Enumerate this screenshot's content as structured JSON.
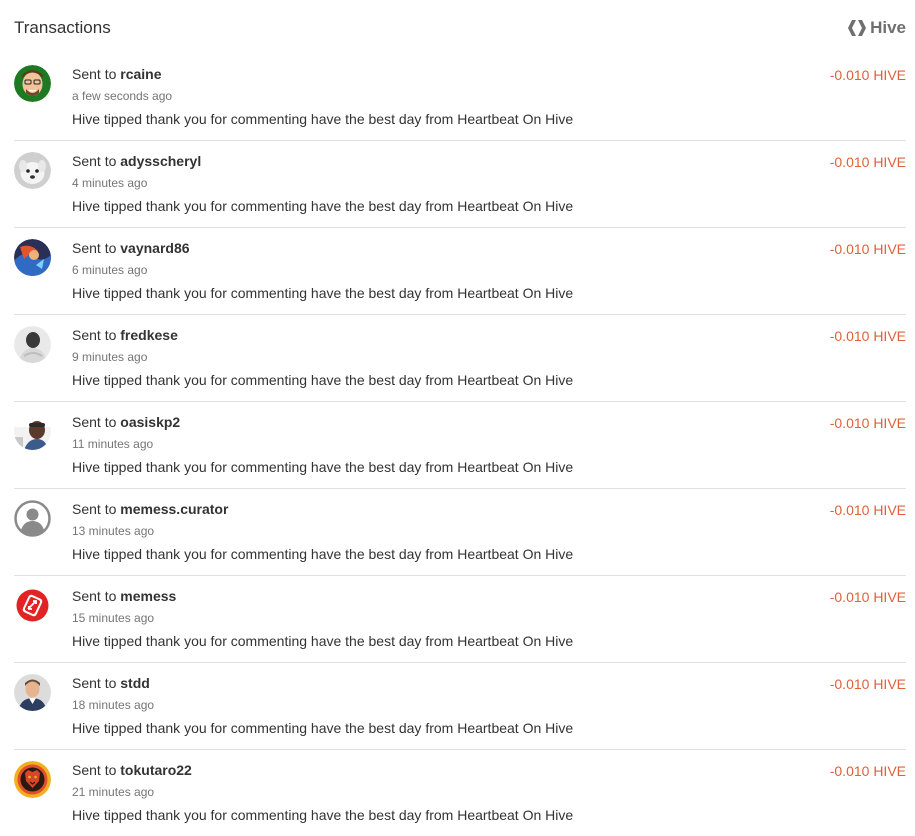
{
  "header": {
    "title": "Transactions",
    "brand_label": "Hive",
    "brand_icon": "hive-logo-icon"
  },
  "transactions": [
    {
      "prefix": "Sent to",
      "recipient": "rcaine",
      "time": "a few seconds ago",
      "memo": "Hive tipped thank you for commenting have the best day from Heartbeat On Hive",
      "amount": "-0.010 HIVE",
      "avatar": "avatar-cartoon-man-green"
    },
    {
      "prefix": "Sent to",
      "recipient": "adysscheryl",
      "time": "4 minutes ago",
      "memo": "Hive tipped thank you for commenting have the best day from Heartbeat On Hive",
      "amount": "-0.010 HIVE",
      "avatar": "avatar-white-dog"
    },
    {
      "prefix": "Sent to",
      "recipient": "vaynard86",
      "time": "6 minutes ago",
      "memo": "Hive tipped thank you for commenting have the best day from Heartbeat On Hive",
      "amount": "-0.010 HIVE",
      "avatar": "avatar-game-character"
    },
    {
      "prefix": "Sent to",
      "recipient": "fredkese",
      "time": "9 minutes ago",
      "memo": "Hive tipped thank you for commenting have the best day from Heartbeat On Hive",
      "amount": "-0.010 HIVE",
      "avatar": "avatar-grayscale-person"
    },
    {
      "prefix": "Sent to",
      "recipient": "oasiskp2",
      "time": "11 minutes ago",
      "memo": "Hive tipped thank you for commenting have the best day from Heartbeat On Hive",
      "amount": "-0.010 HIVE",
      "avatar": "avatar-person-outdoor"
    },
    {
      "prefix": "Sent to",
      "recipient": "memess.curator",
      "time": "13 minutes ago",
      "memo": "Hive tipped thank you for commenting have the best day from Heartbeat On Hive",
      "amount": "-0.010 HIVE",
      "avatar": "avatar-default-user-icon"
    },
    {
      "prefix": "Sent to",
      "recipient": "memess",
      "time": "15 minutes ago",
      "memo": "Hive tipped thank you for commenting have the best day from Heartbeat On Hive",
      "amount": "-0.010 HIVE",
      "avatar": "avatar-red-card-logo"
    },
    {
      "prefix": "Sent to",
      "recipient": "stdd",
      "time": "18 minutes ago",
      "memo": "Hive tipped thank you for commenting have the best day from Heartbeat On Hive",
      "amount": "-0.010 HIVE",
      "avatar": "avatar-man-portrait"
    },
    {
      "prefix": "Sent to",
      "recipient": "tokutaro22",
      "time": "21 minutes ago",
      "memo": "Hive tipped thank you for commenting have the best day from Heartbeat On Hive",
      "amount": "-0.010 HIVE",
      "avatar": "avatar-lion-badge"
    }
  ],
  "colors": {
    "amount": "#e0603a",
    "divider": "#e0e0e0",
    "text": "#333333",
    "muted": "#757575"
  }
}
